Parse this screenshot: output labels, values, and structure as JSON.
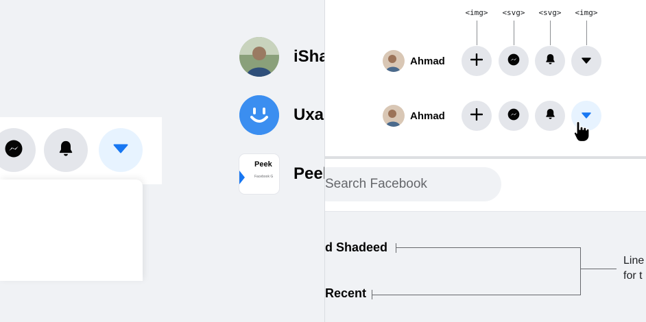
{
  "colors": {
    "accent": "#1877f2",
    "button_bg": "#e4e6eb",
    "active_bg": "#e7f3ff",
    "page_bg": "#f0f2f5"
  },
  "left": {
    "nav_icons": [
      "messenger-icon",
      "bell-icon",
      "caret-down-icon"
    ],
    "list": [
      {
        "label": "iSha",
        "icon": "profile-photo"
      },
      {
        "label": "Uxal",
        "icon": "smiley-logo"
      },
      {
        "label": "Peel",
        "icon": "peeks-logo",
        "logo_text": "Peek",
        "logo_sub": "Facebook G"
      }
    ]
  },
  "right": {
    "tags": [
      "<img>",
      "<svg>",
      "<svg>",
      "<img>"
    ],
    "rows": [
      {
        "user": "Ahmad",
        "icons": [
          "plus-icon",
          "messenger-icon",
          "bell-icon",
          "caret-down-icon"
        ]
      },
      {
        "user": "Ahmad",
        "icons": [
          "plus-icon",
          "messenger-icon",
          "bell-icon",
          "caret-down-icon"
        ],
        "active_index": 3
      }
    ],
    "search_placeholder": "Search Facebook",
    "labels": [
      "d Shadeed",
      "Recent"
    ],
    "note_lines": [
      "Line",
      "for t"
    ]
  }
}
